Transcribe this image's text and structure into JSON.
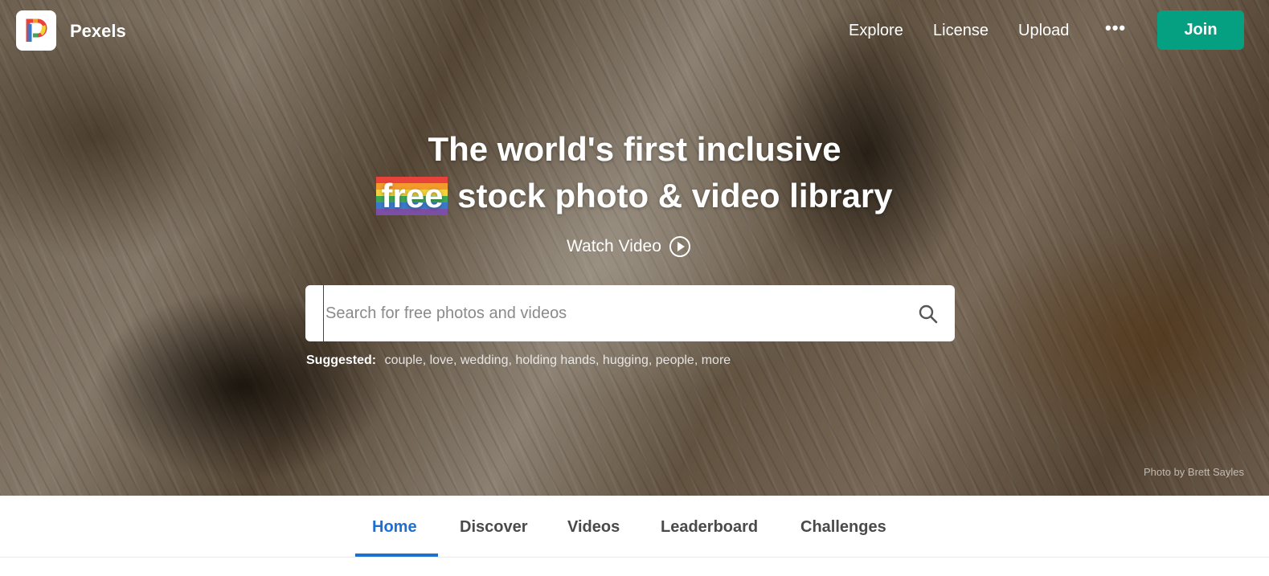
{
  "brand": {
    "name": "Pexels"
  },
  "nav": {
    "explore": "Explore",
    "license": "License",
    "upload": "Upload",
    "more": "•••",
    "join": "Join"
  },
  "hero": {
    "line1": "The world's first inclusive",
    "free_word": "free",
    "line2_rest": " stock photo & video library",
    "watch_video": "Watch Video",
    "photo_credit": "Photo by Brett Sayles"
  },
  "search": {
    "placeholder": "Search for free photos and videos",
    "value": "",
    "suggested_label": "Suggested:",
    "suggestions": [
      "couple,",
      "love,",
      "wedding,",
      "holding hands,",
      "hugging,",
      "people,",
      "more"
    ]
  },
  "tabs": [
    {
      "label": "Home",
      "active": true
    },
    {
      "label": "Discover",
      "active": false
    },
    {
      "label": "Videos",
      "active": false
    },
    {
      "label": "Leaderboard",
      "active": false
    },
    {
      "label": "Challenges",
      "active": false
    }
  ],
  "colors": {
    "join_button": "#05a081",
    "active_tab": "#1f6fd1"
  }
}
